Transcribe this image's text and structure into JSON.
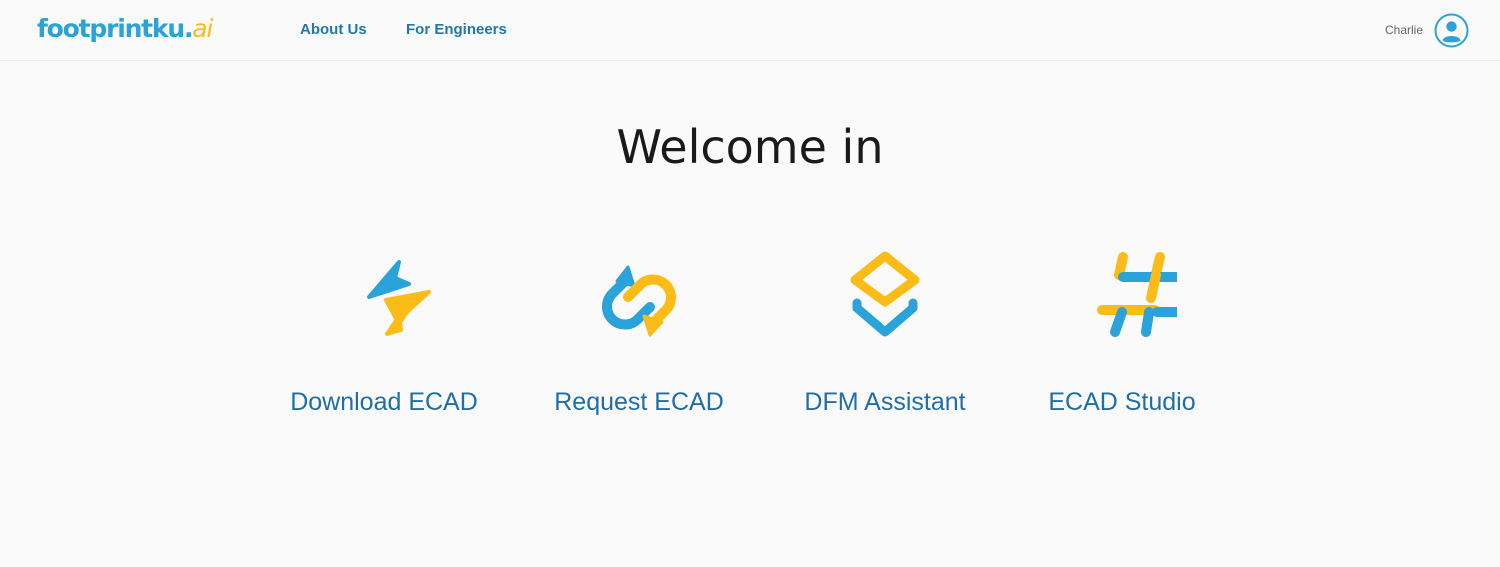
{
  "header": {
    "logo": {
      "main": "footprintku",
      "dot": ".",
      "ai": "ai"
    },
    "nav": [
      {
        "label": "About Us"
      },
      {
        "label": "For Engineers"
      }
    ],
    "user": {
      "name": "Charlie",
      "icon": "user-avatar-icon"
    }
  },
  "main": {
    "title": "Welcome in",
    "cards": [
      {
        "label": "Download ECAD",
        "icon": "lightning-bolt-icon"
      },
      {
        "label": "Request ECAD",
        "icon": "circular-arrows-icon"
      },
      {
        "label": "DFM Assistant",
        "icon": "layers-icon"
      },
      {
        "label": "ECAD Studio",
        "icon": "hash-icon"
      }
    ]
  },
  "colors": {
    "brand_blue": "#29a3da",
    "brand_yellow": "#fbbc17",
    "link_blue": "#2078ad",
    "card_label": "#1f6ea8"
  }
}
